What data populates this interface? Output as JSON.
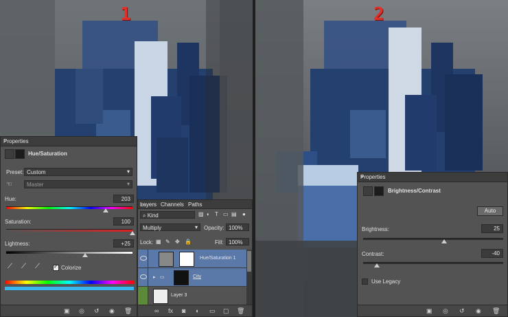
{
  "step_labels": {
    "left": "1",
    "right": "2"
  },
  "hue_panel": {
    "title": "Properties",
    "header": "Hue/Saturation",
    "preset_label": "Preset:",
    "preset_value": "Custom",
    "channel_value": "Master",
    "hue_label": "Hue:",
    "hue_value": "203",
    "hue_fraction": 0.79,
    "saturation_label": "Saturation:",
    "saturation_value": "100",
    "saturation_fraction": 1.0,
    "lightness_label": "Lightness:",
    "lightness_value": "+25",
    "lightness_fraction": 0.625,
    "colorize_label": "Colorize",
    "colorize_checked": true
  },
  "layers_panel": {
    "tabs": [
      "Layers",
      "Channels",
      "Paths"
    ],
    "filter_kind": "Kind",
    "blend_mode": "Multiply",
    "opacity_label": "Opacity:",
    "opacity_value": "100%",
    "lock_label": "Lock:",
    "fill_label": "Fill:",
    "fill_value": "100%",
    "layers": [
      {
        "name": "Hue/Saturation 1",
        "selected": true
      },
      {
        "name": "City",
        "selected": true
      },
      {
        "name": "Layer 3",
        "selected": false
      }
    ]
  },
  "bc_panel": {
    "title": "Properties",
    "header": "Brightness/Contrast",
    "auto_label": "Auto",
    "brightness_label": "Brightness:",
    "brightness_value": "25",
    "brightness_fraction": 0.58,
    "contrast_label": "Contrast:",
    "contrast_value": "-40",
    "contrast_fraction": 0.1,
    "legacy_label": "Use Legacy",
    "legacy_checked": false
  },
  "colors": {
    "panel_bg": "#535353",
    "title_bg": "#3c3c3c",
    "selected_row": "#5a78a8",
    "step_red": "#e0302a",
    "sky": "#2a4a7a"
  }
}
